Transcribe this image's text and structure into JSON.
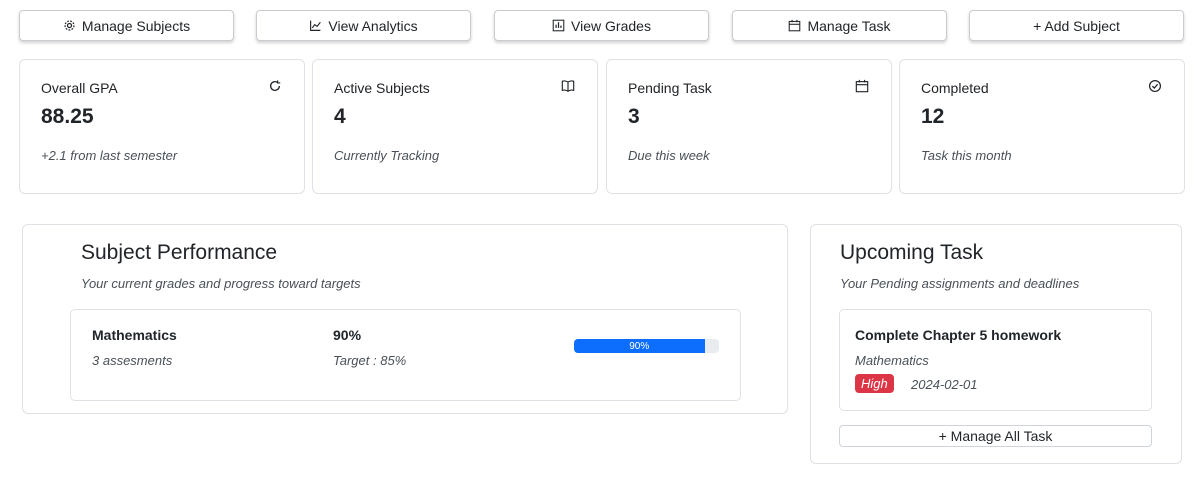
{
  "toolbar": {
    "manage_subjects": "Manage Subjects",
    "view_analytics": "View Analytics",
    "view_grades": "View Grades",
    "manage_task": "Manage Task",
    "add_subject": "+ Add Subject"
  },
  "stats": [
    {
      "label": "Overall GPA",
      "value": "88.25",
      "sub": "+2.1 from last semester",
      "icon": "refresh-icon"
    },
    {
      "label": "Active Subjects",
      "value": "4",
      "sub": "Currently Tracking",
      "icon": "book-icon"
    },
    {
      "label": "Pending Task",
      "value": "3",
      "sub": "Due this week",
      "icon": "calendar-icon"
    },
    {
      "label": "Completed",
      "value": "12",
      "sub": "Task this month",
      "icon": "check-circle-icon"
    }
  ],
  "performance": {
    "title": "Subject Performance",
    "subtitle": "Your current grades and progress toward targets",
    "subjects": [
      {
        "name": "Mathematics",
        "assessments": "3 assesments",
        "grade": "90%",
        "target": "Target : 85%",
        "progress": 90,
        "progress_label": "90%"
      }
    ]
  },
  "upcoming": {
    "title": "Upcoming Task",
    "subtitle": "Your Pending assignments and deadlines",
    "tasks": [
      {
        "title": "Complete Chapter 5 homework",
        "subject": "Mathematics",
        "priority": "High",
        "date": "2024-02-01"
      }
    ],
    "manage_all": "+ Manage All Task"
  },
  "colors": {
    "accent": "#0d6efd",
    "danger": "#dc3545",
    "border": "#dee2e6"
  }
}
